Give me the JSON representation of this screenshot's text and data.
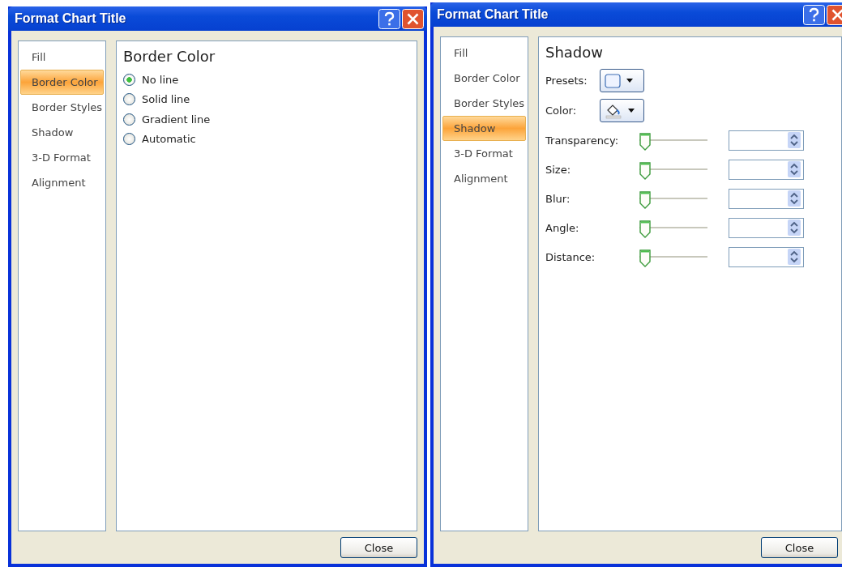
{
  "dialogs": [
    {
      "title": "Format Chart Title",
      "categories": [
        {
          "label": "Fill",
          "selected": false
        },
        {
          "label": "Border Color",
          "selected": true
        },
        {
          "label": "Border Styles",
          "selected": false
        },
        {
          "label": "Shadow",
          "selected": false
        },
        {
          "label": "3-D Format",
          "selected": false
        },
        {
          "label": "Alignment",
          "selected": false
        }
      ],
      "panel": {
        "kind": "border_color",
        "heading": "Border Color",
        "options": [
          {
            "label": "No line",
            "selected": true
          },
          {
            "label": "Solid line",
            "selected": false
          },
          {
            "label": "Gradient line",
            "selected": false
          },
          {
            "label": "Automatic",
            "selected": false
          }
        ]
      },
      "close_button": "Close"
    },
    {
      "title": "Format Chart Title",
      "categories": [
        {
          "label": "Fill",
          "selected": false
        },
        {
          "label": "Border Color",
          "selected": false
        },
        {
          "label": "Border Styles",
          "selected": false
        },
        {
          "label": "Shadow",
          "selected": true
        },
        {
          "label": "3-D Format",
          "selected": false
        },
        {
          "label": "Alignment",
          "selected": false
        }
      ],
      "panel": {
        "kind": "shadow",
        "heading": "Shadow",
        "pickers": [
          {
            "label": "Presets:",
            "kind": "preset"
          },
          {
            "label": "Color:",
            "kind": "color"
          }
        ],
        "sliders": [
          {
            "label": "Transparency:",
            "level": 0
          },
          {
            "label": "Size:",
            "level": 0
          },
          {
            "label": "Blur:",
            "level": 0
          },
          {
            "label": "Angle:",
            "level": 0
          },
          {
            "label": "Distance:",
            "level": 0
          }
        ]
      },
      "close_button": "Close"
    }
  ]
}
